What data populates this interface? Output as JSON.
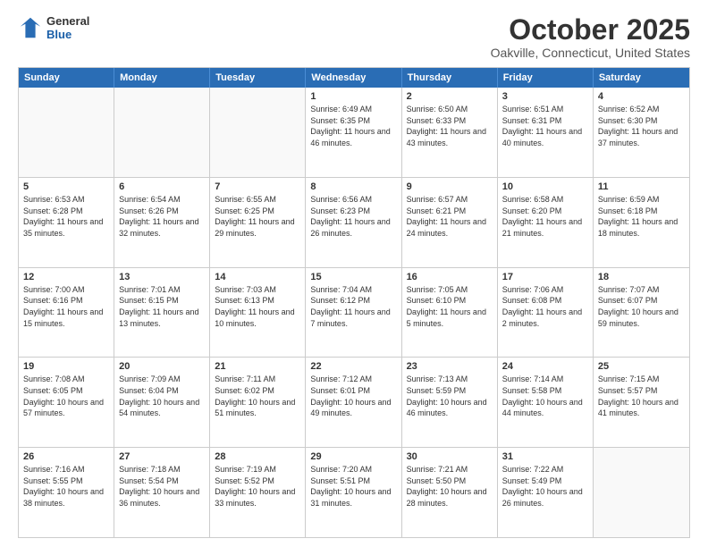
{
  "logo": {
    "general": "General",
    "blue": "Blue"
  },
  "header": {
    "month": "October 2025",
    "location": "Oakville, Connecticut, United States"
  },
  "days": [
    "Sunday",
    "Monday",
    "Tuesday",
    "Wednesday",
    "Thursday",
    "Friday",
    "Saturday"
  ],
  "rows": [
    [
      {
        "day": "",
        "empty": true
      },
      {
        "day": "",
        "empty": true
      },
      {
        "day": "",
        "empty": true
      },
      {
        "day": "1",
        "sun": "6:49 AM",
        "set": "6:35 PM",
        "dl": "11 hours and 46 minutes."
      },
      {
        "day": "2",
        "sun": "6:50 AM",
        "set": "6:33 PM",
        "dl": "11 hours and 43 minutes."
      },
      {
        "day": "3",
        "sun": "6:51 AM",
        "set": "6:31 PM",
        "dl": "11 hours and 40 minutes."
      },
      {
        "day": "4",
        "sun": "6:52 AM",
        "set": "6:30 PM",
        "dl": "11 hours and 37 minutes."
      }
    ],
    [
      {
        "day": "5",
        "sun": "6:53 AM",
        "set": "6:28 PM",
        "dl": "11 hours and 35 minutes."
      },
      {
        "day": "6",
        "sun": "6:54 AM",
        "set": "6:26 PM",
        "dl": "11 hours and 32 minutes."
      },
      {
        "day": "7",
        "sun": "6:55 AM",
        "set": "6:25 PM",
        "dl": "11 hours and 29 minutes."
      },
      {
        "day": "8",
        "sun": "6:56 AM",
        "set": "6:23 PM",
        "dl": "11 hours and 26 minutes."
      },
      {
        "day": "9",
        "sun": "6:57 AM",
        "set": "6:21 PM",
        "dl": "11 hours and 24 minutes."
      },
      {
        "day": "10",
        "sun": "6:58 AM",
        "set": "6:20 PM",
        "dl": "11 hours and 21 minutes."
      },
      {
        "day": "11",
        "sun": "6:59 AM",
        "set": "6:18 PM",
        "dl": "11 hours and 18 minutes."
      }
    ],
    [
      {
        "day": "12",
        "sun": "7:00 AM",
        "set": "6:16 PM",
        "dl": "11 hours and 15 minutes."
      },
      {
        "day": "13",
        "sun": "7:01 AM",
        "set": "6:15 PM",
        "dl": "11 hours and 13 minutes."
      },
      {
        "day": "14",
        "sun": "7:03 AM",
        "set": "6:13 PM",
        "dl": "11 hours and 10 minutes."
      },
      {
        "day": "15",
        "sun": "7:04 AM",
        "set": "6:12 PM",
        "dl": "11 hours and 7 minutes."
      },
      {
        "day": "16",
        "sun": "7:05 AM",
        "set": "6:10 PM",
        "dl": "11 hours and 5 minutes."
      },
      {
        "day": "17",
        "sun": "7:06 AM",
        "set": "6:08 PM",
        "dl": "11 hours and 2 minutes."
      },
      {
        "day": "18",
        "sun": "7:07 AM",
        "set": "6:07 PM",
        "dl": "10 hours and 59 minutes."
      }
    ],
    [
      {
        "day": "19",
        "sun": "7:08 AM",
        "set": "6:05 PM",
        "dl": "10 hours and 57 minutes."
      },
      {
        "day": "20",
        "sun": "7:09 AM",
        "set": "6:04 PM",
        "dl": "10 hours and 54 minutes."
      },
      {
        "day": "21",
        "sun": "7:11 AM",
        "set": "6:02 PM",
        "dl": "10 hours and 51 minutes."
      },
      {
        "day": "22",
        "sun": "7:12 AM",
        "set": "6:01 PM",
        "dl": "10 hours and 49 minutes."
      },
      {
        "day": "23",
        "sun": "7:13 AM",
        "set": "5:59 PM",
        "dl": "10 hours and 46 minutes."
      },
      {
        "day": "24",
        "sun": "7:14 AM",
        "set": "5:58 PM",
        "dl": "10 hours and 44 minutes."
      },
      {
        "day": "25",
        "sun": "7:15 AM",
        "set": "5:57 PM",
        "dl": "10 hours and 41 minutes."
      }
    ],
    [
      {
        "day": "26",
        "sun": "7:16 AM",
        "set": "5:55 PM",
        "dl": "10 hours and 38 minutes."
      },
      {
        "day": "27",
        "sun": "7:18 AM",
        "set": "5:54 PM",
        "dl": "10 hours and 36 minutes."
      },
      {
        "day": "28",
        "sun": "7:19 AM",
        "set": "5:52 PM",
        "dl": "10 hours and 33 minutes."
      },
      {
        "day": "29",
        "sun": "7:20 AM",
        "set": "5:51 PM",
        "dl": "10 hours and 31 minutes."
      },
      {
        "day": "30",
        "sun": "7:21 AM",
        "set": "5:50 PM",
        "dl": "10 hours and 28 minutes."
      },
      {
        "day": "31",
        "sun": "7:22 AM",
        "set": "5:49 PM",
        "dl": "10 hours and 26 minutes."
      },
      {
        "day": "",
        "empty": true
      }
    ]
  ]
}
